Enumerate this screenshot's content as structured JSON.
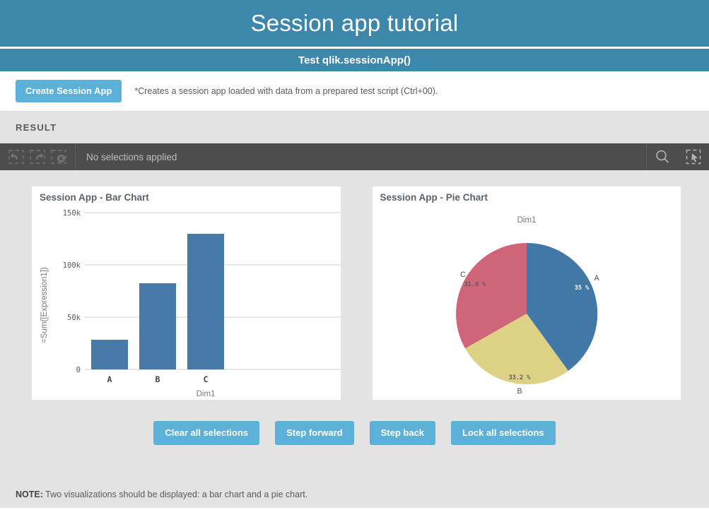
{
  "header": {
    "title": "Session app tutorial",
    "subtitle": "Test qlik.sessionApp()"
  },
  "action": {
    "create_button": "Create Session App",
    "hint": "*Creates a session app loaded with data from a prepared test script (Ctrl+00)."
  },
  "result": {
    "label": "RESULT"
  },
  "selection_toolbar": {
    "status": "No selections applied",
    "icons": {
      "step_back": "step-back-icon",
      "step_forward": "step-forward-icon",
      "clear_selections": "clear-selections-icon",
      "search": "search-icon",
      "selection_tool": "selection-tool-icon"
    }
  },
  "charts": {
    "bar_title": "Session App - Bar Chart",
    "pie_title": "Session App - Pie Chart"
  },
  "chart_data": [
    {
      "type": "bar",
      "title": "Session App - Bar Chart",
      "categories": [
        "A",
        "B",
        "C"
      ],
      "values": [
        28400,
        82500,
        129600
      ],
      "xlabel": "Dim1",
      "ylabel": "=Sum([Expression1])",
      "ylim": [
        0,
        150000
      ],
      "yticks": [
        0,
        50000,
        100000,
        150000
      ],
      "ytick_labels": [
        "0",
        "50k",
        "100k",
        "150k"
      ],
      "grid": true,
      "legend": "none",
      "series_color": "#477aa6"
    },
    {
      "type": "pie",
      "title": "Session App - Pie Chart",
      "dimension_label": "Dim1",
      "categories": [
        "A",
        "B",
        "C"
      ],
      "values": [
        35.0,
        33.2,
        31.8
      ],
      "labels": [
        "35 %",
        "33.2 %",
        "31.8 %"
      ],
      "colors": [
        "#4178a6",
        "#ddd186",
        "#cf6579"
      ],
      "legend": "none",
      "start_angle_deg": 0
    }
  ],
  "footer_buttons": [
    {
      "label": "Clear all selections",
      "name": "clear-all-selections-button"
    },
    {
      "label": "Step forward",
      "name": "step-forward-button"
    },
    {
      "label": "Step back",
      "name": "step-back-button"
    },
    {
      "label": "Lock all selections",
      "name": "lock-all-selections-button"
    }
  ],
  "note": {
    "prefix": "NOTE:",
    "text": "Two visualizations should be displayed: a bar chart and a pie chart."
  }
}
